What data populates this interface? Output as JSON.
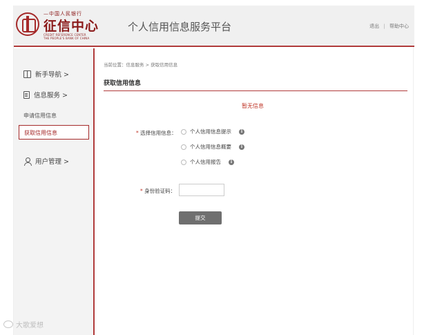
{
  "header": {
    "logo": {
      "top_line": "—中国人民银行",
      "title": "征信中心",
      "en_line1": "CREDIT REFERENCE CENTER",
      "en_line2": "THE PEOPLE'S BANK OF CHINA"
    },
    "platform_title": "个人信用信息服务平台",
    "links": {
      "logout": "退出",
      "separator": "|",
      "help": "帮助中心"
    },
    "accent_color": "#b03a3a"
  },
  "sidebar": {
    "items": [
      {
        "label": "新手导航 >",
        "icon": "book-icon"
      },
      {
        "label": "信息服务 >",
        "icon": "document-icon"
      },
      {
        "label": "用户管理 >",
        "icon": "user-icon"
      }
    ],
    "sub_items": [
      {
        "label": "申请信用信息",
        "active": false
      },
      {
        "label": "获取信用信息",
        "active": true
      }
    ]
  },
  "main": {
    "breadcrumb": "当前位置：信息服务 > 获取信用信息",
    "section_title": "获取信用信息",
    "notice": "暂无信息",
    "form": {
      "select_label": "选择信用信息：",
      "required_mark": "*",
      "options": [
        {
          "label": "个人信用信息提示",
          "checked": false
        },
        {
          "label": "个人信用信息概要",
          "checked": false
        },
        {
          "label": "个人信用报告",
          "checked": false
        }
      ],
      "code_label": "身份验证码：",
      "code_value": "",
      "submit_label": "提交"
    }
  },
  "watermark": "大歌爱想"
}
